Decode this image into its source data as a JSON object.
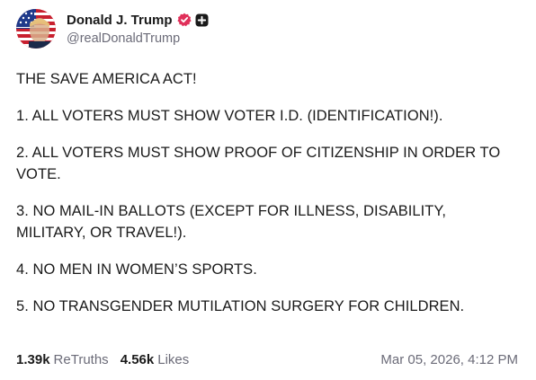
{
  "author": {
    "display_name": "Donald J. Trump",
    "handle": "@realDonaldTrump",
    "avatar_icon": "avatar-image",
    "verified_icon": "verified-badge-icon",
    "extra_icon": "plus-square-icon",
    "verified_color": "#e0305a"
  },
  "post": {
    "paragraphs": [
      "THE SAVE AMERICA ACT!",
      "1. ALL VOTERS MUST SHOW VOTER I.D. (IDENTIFICATION!).",
      "2. ALL VOTERS MUST SHOW PROOF OF CITIZENSHIP IN ORDER TO VOTE.",
      "3. NO MAIL-IN BALLOTS (EXCEPT FOR ILLNESS, DISABILITY, MILITARY, OR TRAVEL!).",
      "4. NO MEN IN WOMEN’S SPORTS.",
      "5. NO TRANSGENDER MUTILATION SURGERY FOR CHILDREN."
    ]
  },
  "stats": {
    "retruths_count": "1.39k",
    "retruths_label": "ReTruths",
    "likes_count": "4.56k",
    "likes_label": "Likes"
  },
  "timestamp": "Mar 05, 2026, 4:12 PM"
}
